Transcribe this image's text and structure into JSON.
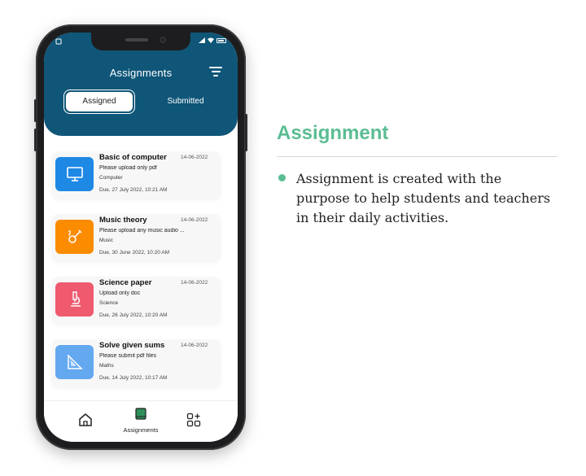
{
  "header": {
    "title": "Assignments",
    "tabs": {
      "assigned": "Assigned",
      "submitted": "Submitted"
    }
  },
  "assignments": [
    {
      "title": "Basic of computer",
      "date": "14-06-2022",
      "description": "Please upload only pdf",
      "subject": "Computer",
      "due": "Due, 27 July 2022, 10:21 AM",
      "icon": "monitor-icon",
      "color": "#1e88e5"
    },
    {
      "title": "Music theory",
      "date": "14-06-2022",
      "description": "Please upload any music audio ...",
      "subject": "Music",
      "due": "Due, 30 June 2022, 10:20 AM",
      "icon": "guitar-icon",
      "color": "#fb8c00"
    },
    {
      "title": "Science paper",
      "date": "14-06-2022",
      "description": "Upload only doc",
      "subject": "Science",
      "due": "Due, 26 July 2022, 10:20 AM",
      "icon": "microscope-icon",
      "color": "#ef5a6f"
    },
    {
      "title": "Solve given sums",
      "date": "14-06-2022",
      "description": "Please submit pdf files",
      "subject": "Maths",
      "due": "Due, 14 July 2022, 10:17 AM",
      "icon": "set-square-icon",
      "color": "#64a8f0"
    }
  ],
  "bottom_nav": {
    "assignments_label": "Assignments"
  },
  "promo": {
    "heading": "Assignment",
    "description": "Assignment is created with the purpose to help students and teachers in their daily activities."
  },
  "colors": {
    "header_bg": "#0f5678",
    "accent_green": "#5bbd92"
  }
}
